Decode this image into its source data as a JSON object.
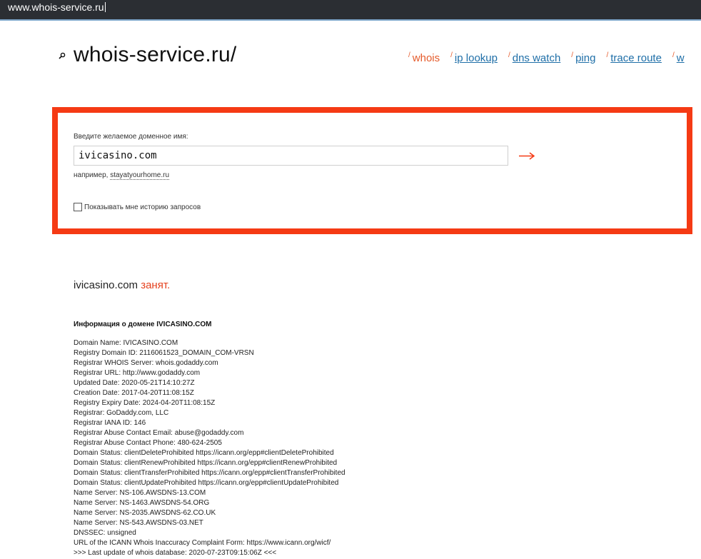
{
  "browser": {
    "url": "www.whois-service.ru"
  },
  "logo": {
    "text": "whois-service.ru/",
    "icon": "magnifier-icon"
  },
  "nav": {
    "items": [
      {
        "label": "whois",
        "active": true
      },
      {
        "label": "ip lookup",
        "active": false
      },
      {
        "label": "dns watch",
        "active": false
      },
      {
        "label": "ping",
        "active": false
      },
      {
        "label": "trace route",
        "active": false
      },
      {
        "label": "w",
        "active": false
      }
    ]
  },
  "search": {
    "label": "Введите желаемое доменное имя:",
    "value": "ivicasino.com",
    "submit_icon": "arrow-right-icon",
    "example_prefix": "например,",
    "example_link": "stayatyourhome.ru",
    "history_label": "Показывать мне историю запросов",
    "history_checked": false
  },
  "result": {
    "domain": "ivicasino.com",
    "status": "занят."
  },
  "info": {
    "title": "Информация о домене IVICASINO.COM",
    "lines": [
      "Domain Name: IVICASINO.COM",
      "Registry Domain ID: 2116061523_DOMAIN_COM-VRSN",
      "Registrar WHOIS Server: whois.godaddy.com",
      "Registrar URL: http://www.godaddy.com",
      "Updated Date: 2020-05-21T14:10:27Z",
      "Creation Date: 2017-04-20T11:08:15Z",
      "Registry Expiry Date: 2024-04-20T11:08:15Z",
      "Registrar: GoDaddy.com, LLC",
      "Registrar IANA ID: 146",
      "Registrar Abuse Contact Email: abuse@godaddy.com",
      "Registrar Abuse Contact Phone: 480-624-2505",
      "Domain Status: clientDeleteProhibited https://icann.org/epp#clientDeleteProhibited",
      "Domain Status: clientRenewProhibited https://icann.org/epp#clientRenewProhibited",
      "Domain Status: clientTransferProhibited https://icann.org/epp#clientTransferProhibited",
      "Domain Status: clientUpdateProhibited https://icann.org/epp#clientUpdateProhibited",
      "Name Server: NS-106.AWSDNS-13.COM",
      "Name Server: NS-1463.AWSDNS-54.ORG",
      "Name Server: NS-2035.AWSDNS-62.CO.UK",
      "Name Server: NS-543.AWSDNS-03.NET",
      "DNSSEC: unsigned",
      "URL of the ICANN Whois Inaccuracy Complaint Form: https://www.icann.org/wicf/",
      ">>> Last update of whois database: 2020-07-23T09:15:06Z <<<"
    ]
  },
  "colors": {
    "accent": "#f53a14",
    "link": "#1f6fa8",
    "address_bar": "#2b2e33"
  }
}
